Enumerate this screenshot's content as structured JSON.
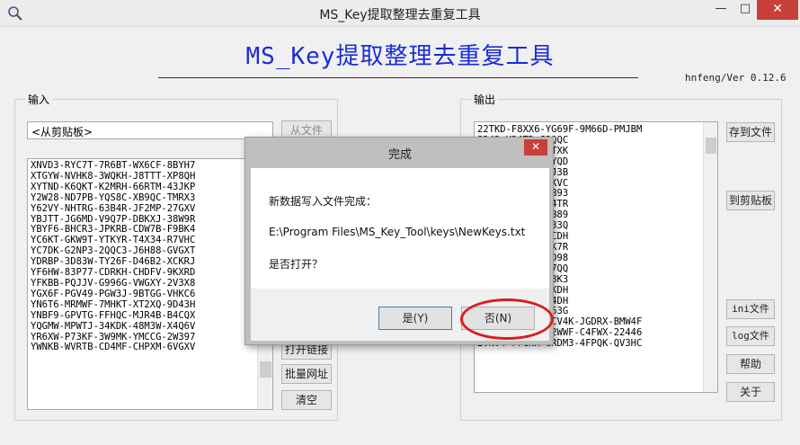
{
  "window": {
    "title": "MS_Key提取整理去重复工具",
    "min": "—",
    "max": "□",
    "close": "✕"
  },
  "banner": {
    "title": "MS_Key提取整理去重复工具",
    "version": "hnfeng/Ver 0.12.6"
  },
  "input": {
    "group_label": "输入",
    "source_select": "<从剪贴板>",
    "from_file_button": "从文件",
    "keys": [
      "XNVD3-RYC7T-7R6BT-WX6CF-8BYH7",
      "XTGYW-NVHK8-3WQKH-J8TTT-XP8QH",
      "XYTND-K6QKT-K2MRH-66RTM-43JKP",
      "Y2W28-ND7PB-YQS8C-XB9QC-TMRX3",
      "Y62VY-NHTRG-63B4R-JF2MP-27GXV",
      "YBJTT-JG6MD-V9Q7P-DBKXJ-38W9R",
      "YBYF6-BHCR3-JPKRB-CDW7B-F9BK4",
      "YC6KT-GKW9T-YTKYR-T4X34-R7VHC",
      "YC7DK-G2NP3-2QQC3-J6H88-GVGXT",
      "YDRBP-3D83W-TY26F-D46B2-XCKRJ",
      "YF6HW-83P77-CDRKH-CHDFV-9KXRD",
      "YFKBB-PQJJV-G996G-VWGXY-2V3X8",
      "YGX6F-PGV49-PGW3J-9BTGG-VHKC6",
      "YN6T6-MRMWF-7MHKT-XT2XQ-9D43H",
      "YNBF9-GPVTG-FFHQC-MJR4B-B4CQX",
      "YQGMW-MPWTJ-34KDK-48M3W-X4Q6V",
      "YR6XW-P73KF-3W9MK-YMCCG-2W397",
      "YWNKB-WVRTB-CD4MF-CHPXM-6VGXV"
    ],
    "buttons": [
      "打开链接",
      "批量网址",
      "清空"
    ]
  },
  "output": {
    "group_label": "输出",
    "keys": [
      "22TKD-F8XX6-YG69F-9M66D-PMJBM",
      "8D42-K34TD-G3QQC",
      "7YWH-JYG9G-D3TXK",
      "XMGD-KYDJV-2DYQD",
      "P8C6-8G773-3MJ3B",
      "BK7B-8C62J-82KVC",
      "YK3Y-MPBGB-FGB93",
      "72PT-484GQ-464TR",
      "RG46-HWPQY-K6B89",
      "PTJX-8CHT6-4M33Q",
      "QGHB-GD849-HCCDH",
      "MFW9-KDQW3-TCK7R",
      "PVF3-Q2WDG-VMD98",
      "Q3PD-2VV42-FX7QQ",
      "3V3W-WC3HB-HT8K3",
      "GXDY-WH7P3-68KDH",
      "GV2V-9Q6K3-C34DH",
      "36D9-4RRVR-2V63G",
      "2RKR3-4322Q-XCV4K-JGDRX-BMW4F",
      "2RY42-DTCWC-62WWF-C4FWX-22446",
      "2VNV4-77CKK-GRDM3-4FPQK-QV3HC"
    ],
    "buttons": {
      "save_file": "存到文件",
      "to_clipboard": "到剪贴板",
      "ini": "ini文件",
      "log": "log文件",
      "help": "帮助",
      "about": "关于"
    }
  },
  "dialog": {
    "title": "完成",
    "close": "✕",
    "message": "新数据写入文件完成：",
    "path": "E:\\Program Files\\MS_Key_Tool\\keys\\NewKeys.txt",
    "question": "是否打开？",
    "yes": "是(Y)",
    "no": "否(N)"
  }
}
